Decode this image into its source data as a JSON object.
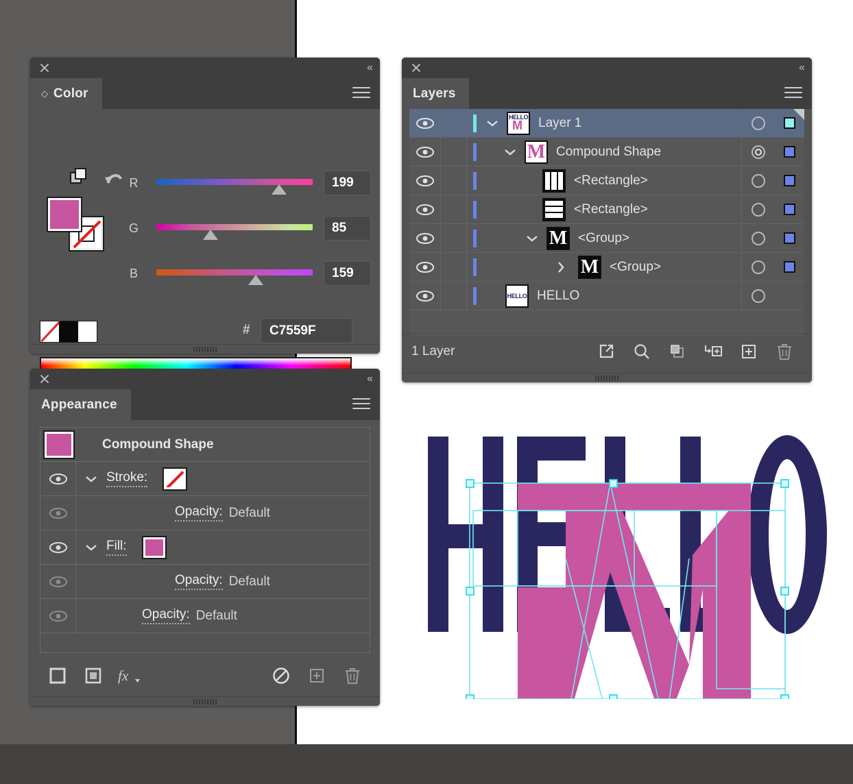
{
  "theme": {
    "panel_bg": "#535353",
    "titlebar_bg": "#3e3e3e",
    "canvas_gray": "#5e5c5b",
    "accent_selected_row": "#5b6b85",
    "layer_color_blue": "#6b84e8",
    "layer_color_teal": "#79e7e1",
    "artwork_navy": "#2A2760",
    "artwork_pink": "#C7559F",
    "selection_cyan": "#6EE8F0"
  },
  "color_panel": {
    "tab_label": "Color",
    "close_icon": "close-icon",
    "collapse_icon": "collapse-icon",
    "menu_icon": "panel-menu-icon",
    "fill_color": "#C7559F",
    "stroke_color": "none",
    "sliders": [
      {
        "channel": "R",
        "value": "199",
        "thumb_pct": 78
      },
      {
        "channel": "G",
        "value": "85",
        "thumb_pct": 33
      },
      {
        "channel": "B",
        "value": "159",
        "thumb_pct": 62
      }
    ],
    "hash_symbol": "#",
    "hex_value": "C7559F",
    "mini_swatches": [
      "none",
      "black",
      "white"
    ]
  },
  "appearance_panel": {
    "tab_label": "Appearance",
    "object_name": "Compound Shape",
    "object_swatch": "#C7559F",
    "rows": [
      {
        "label": "Stroke:",
        "value": "",
        "swatch": "none",
        "has_chevron": true,
        "eye_on": true
      },
      {
        "label": "Opacity:",
        "value": "Default",
        "swatch": null,
        "has_chevron": false,
        "eye_on": false,
        "indent": 1
      },
      {
        "label": "Fill:",
        "value": "",
        "swatch": "#C7559F",
        "has_chevron": true,
        "eye_on": true
      },
      {
        "label": "Opacity:",
        "value": "Default",
        "swatch": null,
        "has_chevron": false,
        "eye_on": false,
        "indent": 1
      },
      {
        "label": "Opacity:",
        "value": "Default",
        "swatch": null,
        "has_chevron": false,
        "eye_on": false,
        "indent": 0
      }
    ],
    "footer_icons": [
      "add-new-stroke-icon",
      "add-new-fill-icon",
      "add-effect-fx-icon",
      "clear-appearance-icon",
      "duplicate-item-icon",
      "delete-item-icon"
    ]
  },
  "layers_panel": {
    "tab_label": "Layers",
    "rows": [
      {
        "name": "Layer 1",
        "thumb": "hello-m-thumb",
        "indent": 0,
        "chevron": "down",
        "selected": true,
        "color": "teal",
        "target": "single",
        "sel_square": "teal",
        "corner_fold": true
      },
      {
        "name": "Compound Shape",
        "thumb": "pink-m-thumb",
        "indent": 1,
        "chevron": "down",
        "selected": false,
        "color": "blue",
        "target": "double",
        "sel_square": "blue",
        "corner_fold": false
      },
      {
        "name": "<Rectangle>",
        "thumb": "vbars-thumb",
        "indent": 2,
        "chevron": "none",
        "selected": false,
        "color": "blue",
        "target": "single",
        "sel_square": "blue",
        "corner_fold": false
      },
      {
        "name": "<Rectangle>",
        "thumb": "hbars-thumb",
        "indent": 2,
        "chevron": "none",
        "selected": false,
        "color": "blue",
        "target": "single",
        "sel_square": "blue",
        "corner_fold": false
      },
      {
        "name": "<Group>",
        "thumb": "black-m-thumb",
        "indent": 2,
        "chevron": "down",
        "selected": false,
        "color": "blue",
        "target": "single",
        "sel_square": "blue",
        "corner_fold": false
      },
      {
        "name": "<Group>",
        "thumb": "black-m-thumb",
        "indent": 3,
        "chevron": "right",
        "selected": false,
        "color": "blue",
        "target": "single",
        "sel_square": "blue",
        "corner_fold": false
      },
      {
        "name": "HELLO",
        "thumb": "hello-text-thumb",
        "indent": 1,
        "chevron": "none",
        "selected": false,
        "color": "blue",
        "target": "single",
        "sel_square": "none",
        "corner_fold": false
      }
    ],
    "footer_count": "1 Layer",
    "footer_icons": [
      "release-to-layers-icon",
      "locate-object-icon",
      "make-clipping-mask-icon",
      "create-sublayer-icon",
      "create-new-layer-icon",
      "delete-selection-icon"
    ]
  },
  "artwork": {
    "text": "HELLO",
    "overlay_letter": "M",
    "text_color": "#2A2760",
    "shape_color": "#C7559F",
    "selection_color": "#6EE8F0",
    "thumb_labels": {
      "hello": "HELLO",
      "m": "M"
    }
  }
}
